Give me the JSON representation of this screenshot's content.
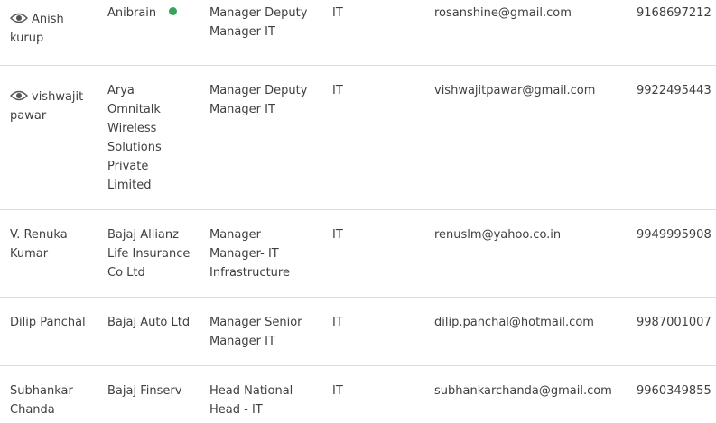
{
  "colors": {
    "online": "#3aa35b",
    "divider": "#dddddd",
    "text": "#404040"
  },
  "rows": [
    {
      "name_line1": "Anish",
      "name_line2": "kurup",
      "has_view_icon": true,
      "company_lines": [
        "Anibrain"
      ],
      "online": true,
      "designation_lines": [
        "Manager Deputy",
        "Manager IT"
      ],
      "department": "IT",
      "email": "rosanshine@gmail.com",
      "phone": "9168697212"
    },
    {
      "name_line1": "vishwajit",
      "name_line2": "pawar",
      "has_view_icon": true,
      "company_lines": [
        "Arya",
        "Omnitalk",
        "Wireless",
        "Solutions",
        "Private",
        "Limited"
      ],
      "online": false,
      "designation_lines": [
        "Manager Deputy",
        "Manager IT"
      ],
      "department": "IT",
      "email": "vishwajitpawar@gmail.com",
      "phone": "9922495443"
    },
    {
      "name_line1": "V. Renuka",
      "name_line2": "Kumar",
      "has_view_icon": false,
      "company_lines": [
        "Bajaj Allianz",
        "Life Insurance",
        "Co Ltd"
      ],
      "online": false,
      "designation_lines": [
        "Manager",
        "Manager- IT",
        "Infrastructure"
      ],
      "department": "IT",
      "email": "renuslm@yahoo.co.in",
      "phone": "9949995908"
    },
    {
      "name_line1": "Dilip Panchal",
      "name_line2": "",
      "has_view_icon": false,
      "company_lines": [
        "Bajaj Auto Ltd"
      ],
      "online": false,
      "designation_lines": [
        "Manager Senior",
        "Manager IT"
      ],
      "department": "IT",
      "email": "dilip.panchal@hotmail.com",
      "phone": "9987001007"
    },
    {
      "name_line1": "Subhankar",
      "name_line2": "Chanda",
      "has_view_icon": false,
      "company_lines": [
        "Bajaj Finserv"
      ],
      "online": false,
      "designation_lines": [
        "Head National",
        "Head - IT"
      ],
      "department": "IT",
      "email": "subhankarchanda@gmail.com",
      "phone": "9960349855"
    }
  ]
}
